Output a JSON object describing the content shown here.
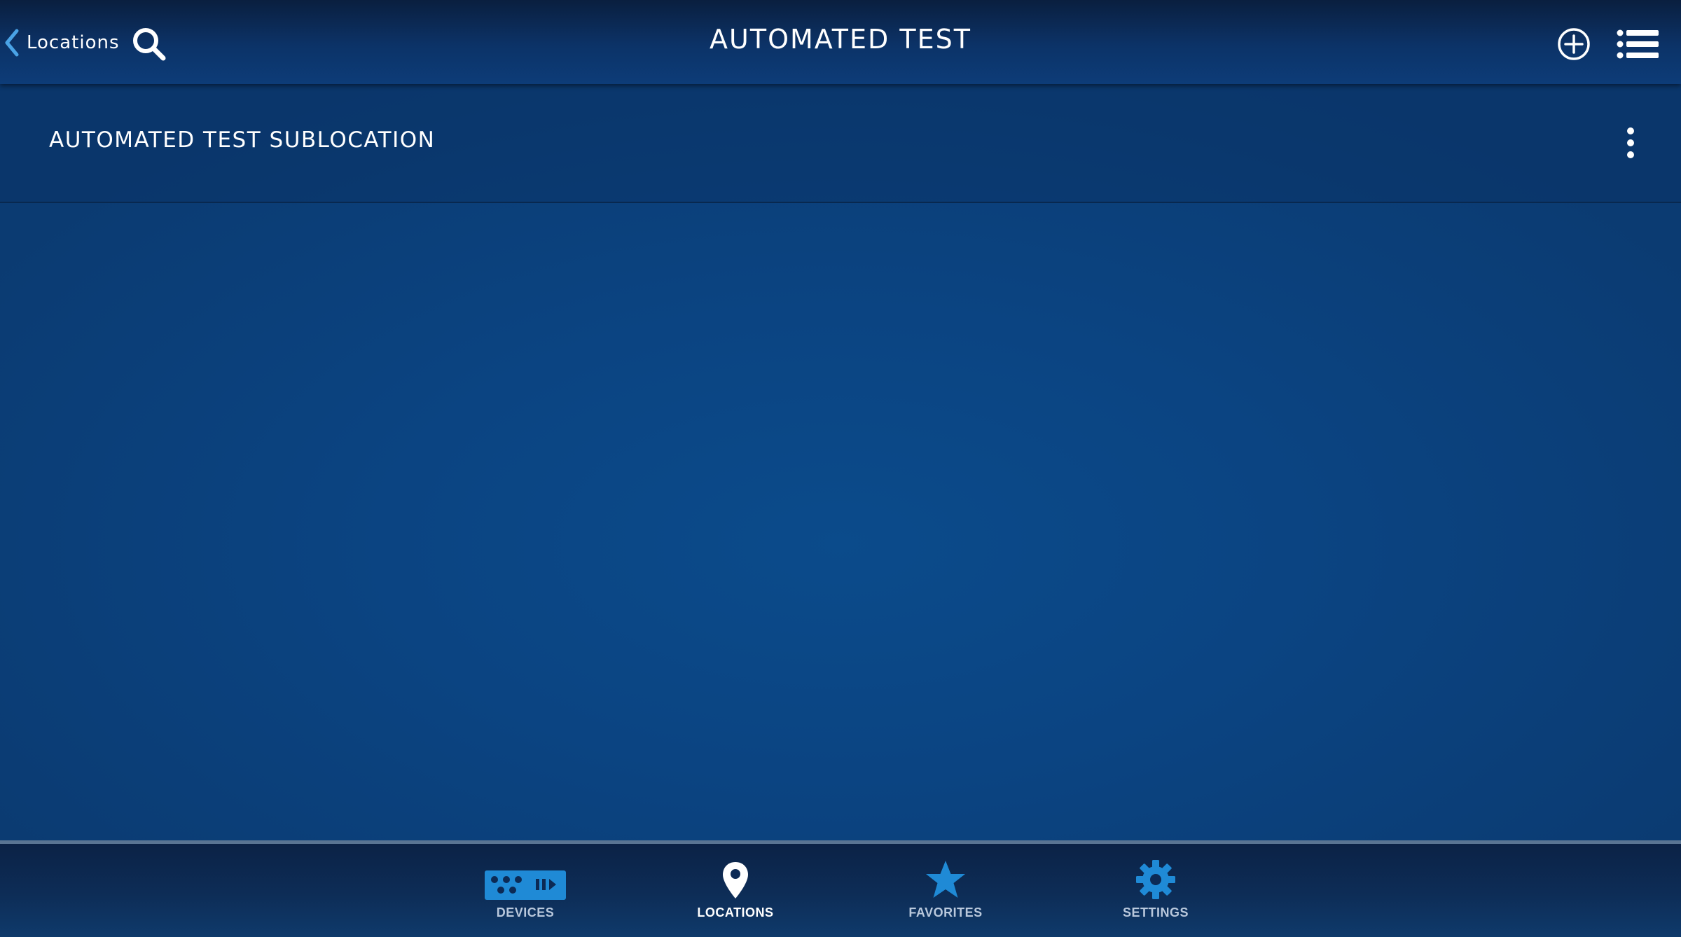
{
  "header": {
    "back_label": "Locations",
    "title": "AUTOMATED TEST",
    "icons": [
      "chevron-left-icon",
      "search-icon",
      "add-circle-icon",
      "list-icon"
    ]
  },
  "list": {
    "items": [
      {
        "label": "AUTOMATED TEST SUBLOCATION",
        "menu_icon": "kebab-menu-icon"
      }
    ]
  },
  "tabbar": {
    "active": "LOCATIONS",
    "tabs": [
      {
        "label": "DEVICES",
        "icon": "devices-icon"
      },
      {
        "label": "LOCATIONS",
        "icon": "location-pin-icon"
      },
      {
        "label": "FAVORITES",
        "icon": "star-icon"
      },
      {
        "label": "SETTINGS",
        "icon": "gear-icon"
      }
    ]
  },
  "colors": {
    "accent": "#1f8ad6",
    "back_chevron": "#4aa3e6",
    "background": "#0b4482",
    "tab_inactive_text": "#b9c8dc"
  }
}
